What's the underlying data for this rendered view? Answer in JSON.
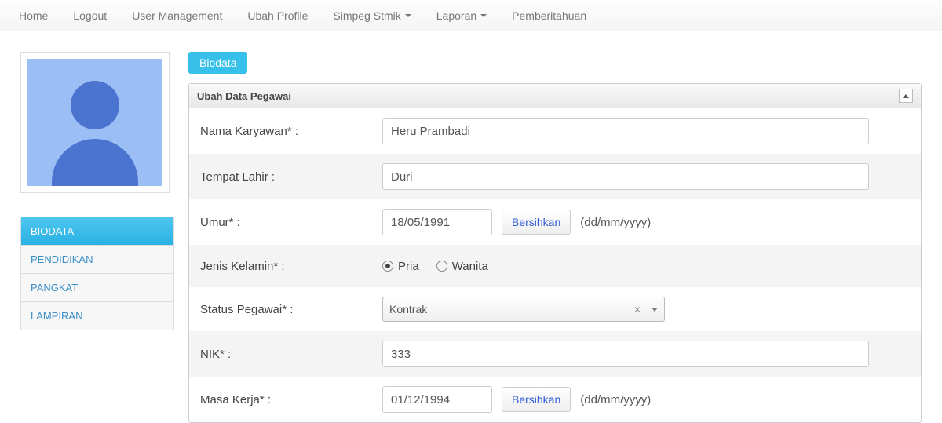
{
  "nav": {
    "items": [
      {
        "label": "Home",
        "dropdown": false
      },
      {
        "label": "Logout",
        "dropdown": false
      },
      {
        "label": "User Management",
        "dropdown": false
      },
      {
        "label": "Ubah Profile",
        "dropdown": false
      },
      {
        "label": "Simpeg Stmik",
        "dropdown": true
      },
      {
        "label": "Laporan",
        "dropdown": true
      },
      {
        "label": "Pemberitahuan",
        "dropdown": false
      }
    ]
  },
  "sidebar": {
    "tabs": [
      {
        "label": "BIODATA",
        "active": true
      },
      {
        "label": "PENDIDIKAN",
        "active": false
      },
      {
        "label": "PANGKAT",
        "active": false
      },
      {
        "label": "LAMPIRAN",
        "active": false
      }
    ]
  },
  "section_badge": "Biodata",
  "panel": {
    "title": "Ubah Data Pegawai"
  },
  "form": {
    "nama": {
      "label": "Nama Karyawan* :",
      "value": "Heru Prambadi"
    },
    "tempat": {
      "label": "Tempat Lahir :",
      "value": "Duri"
    },
    "umur": {
      "label": "Umur* :",
      "value": "18/05/1991",
      "clear": "Bersihkan",
      "hint": "(dd/mm/yyyy)"
    },
    "jk": {
      "label": "Jenis Kelamin* :",
      "opts": [
        "Pria",
        "Wanita"
      ],
      "selected": "Pria"
    },
    "status": {
      "label": "Status Pegawai* :",
      "value": "Kontrak"
    },
    "nik": {
      "label": "NIK* :",
      "value": "333"
    },
    "masa": {
      "label": "Masa Kerja* :",
      "value": "01/12/1994",
      "clear": "Bersihkan",
      "hint": "(dd/mm/yyyy)"
    }
  }
}
